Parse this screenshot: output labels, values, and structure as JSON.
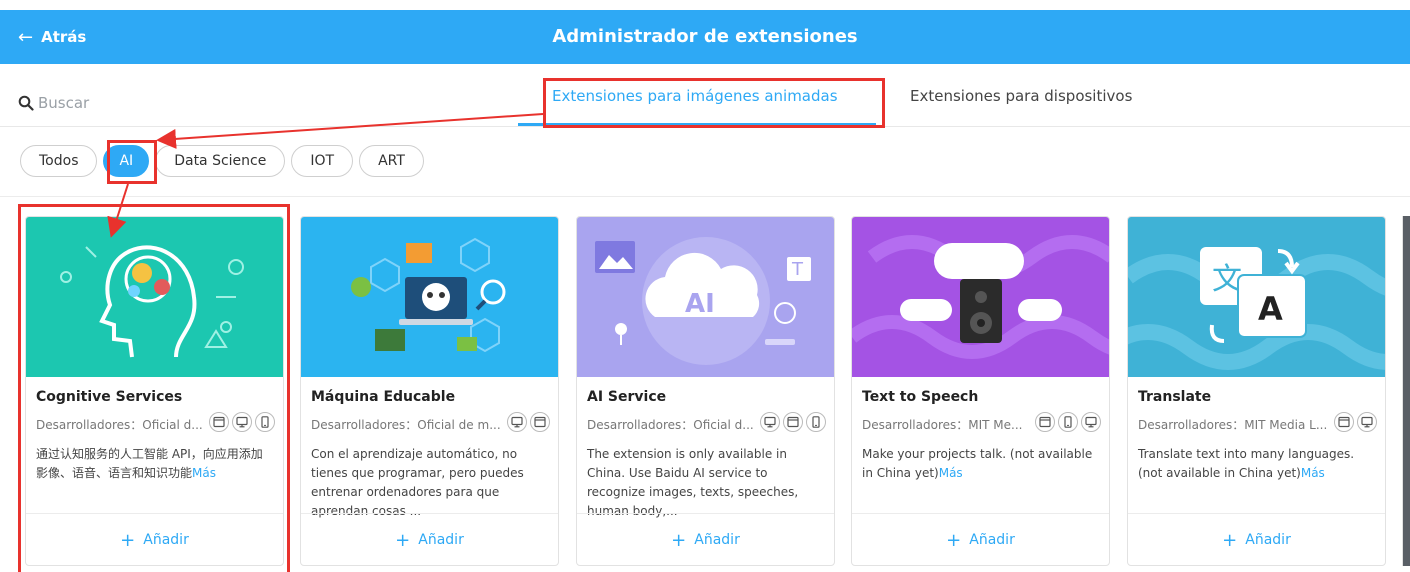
{
  "header": {
    "back_label": "Atrás",
    "title": "Administrador de extensiones"
  },
  "search": {
    "placeholder": "Buscar"
  },
  "tabs": [
    {
      "label": "Extensiones para imágenes animadas",
      "active": true
    },
    {
      "label": "Extensiones para dispositivos",
      "active": false
    }
  ],
  "filters": [
    {
      "label": "Todos",
      "active": false
    },
    {
      "label": "AI",
      "active": true
    },
    {
      "label": "Data Science",
      "active": false
    },
    {
      "label": "IOT",
      "active": false
    },
    {
      "label": "ART",
      "active": false
    }
  ],
  "cards": [
    {
      "name": "Cognitive Services",
      "developer": "Desarrolladores：Oficial d...",
      "devices": [
        "browser-icon",
        "desktop-icon",
        "mobile-icon"
      ],
      "description": "通过认知服务的人工智能 API，向应用添加影像、语音、语言和知识功能",
      "more": "Más",
      "add_label": "Añadir",
      "image_color": "#1cc7b0"
    },
    {
      "name": "Máquina Educable",
      "developer": "Desarrolladores：Oficial de m...",
      "devices": [
        "desktop-icon",
        "browser-icon"
      ],
      "description": "Con el aprendizaje automático, no tienes que programar, pero puedes entrenar ordenadores para que aprendan cosas ...",
      "more": "",
      "add_label": "Añadir",
      "image_color": "#2bb4f0"
    },
    {
      "name": "AI Service",
      "developer": "Desarrolladores：Oficial d...",
      "devices": [
        "desktop-icon",
        "browser-icon",
        "mobile-icon"
      ],
      "description": "The extension is only available in China. Use Baidu AI service to recognize images, texts, speeches, human body,...",
      "more": "",
      "add_label": "Añadir",
      "image_color": "#a9a4ef"
    },
    {
      "name": "Text to Speech",
      "developer": "Desarrolladores：MIT Me...",
      "devices": [
        "browser-icon",
        "mobile-icon",
        "desktop-icon"
      ],
      "description": "Make your projects talk. (not available in China yet)",
      "more": "Más",
      "add_label": "Añadir",
      "image_color": "#a453e4"
    },
    {
      "name": "Translate",
      "developer": "Desarrolladores：MIT Media L...",
      "devices": [
        "browser-icon",
        "desktop-icon"
      ],
      "description": "Translate text into many languages. (not available in China yet)",
      "more": "Más",
      "add_label": "Añadir",
      "image_color": "#3fb2d6"
    }
  ],
  "colors": {
    "accent": "#2ea9f5",
    "annotation": "#e8322d"
  }
}
